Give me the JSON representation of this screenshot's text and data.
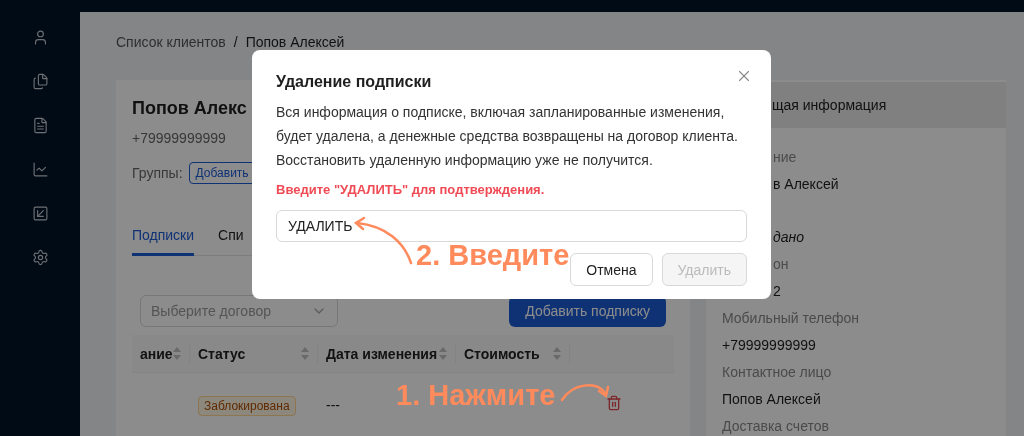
{
  "breadcrumb": {
    "items": [
      "Список клиентов",
      "Попов Алексей"
    ],
    "separator": "/"
  },
  "client": {
    "name": "Попов Алекс",
    "phone": "+79999999999",
    "groups_label": "Группы:",
    "groups_button": "Добавить"
  },
  "tabs": [
    {
      "label": "Подписки",
      "selected": true
    },
    {
      "label": "Спи",
      "selected": false
    }
  ],
  "contract_select": {
    "placeholder": "Выберите договор"
  },
  "add_button": "Добавить подписку",
  "table": {
    "columns": [
      "ание",
      "Статус",
      "Дата изменения",
      "Стоимость"
    ],
    "rows": [
      {
        "status": "Заблокирована",
        "changed": "---"
      }
    ]
  },
  "info_panel": {
    "title": "щая информация",
    "items": [
      {
        "kind": "label",
        "text": "ние",
        "clipped": true
      },
      {
        "kind": "value",
        "text": "в Алексей",
        "clipped": true
      },
      {
        "kind": "note",
        "text": "дано",
        "clipped": true
      },
      {
        "kind": "label",
        "text": "он",
        "clipped": true
      },
      {
        "kind": "value",
        "text": "2",
        "clipped": true
      },
      {
        "kind": "label",
        "text": "Мобильный телефон",
        "clipped": false
      },
      {
        "kind": "value",
        "text": "+79999999999",
        "clipped": false
      },
      {
        "kind": "label",
        "text": "Контактное лицо",
        "clipped": false
      },
      {
        "kind": "value",
        "text": "Попов Алексей",
        "clipped": false
      },
      {
        "kind": "label",
        "text": "Доставка счетов",
        "clipped": false
      }
    ]
  },
  "dialog": {
    "title": "Удаление подписки",
    "body": [
      "Вся информация о подписке, включая запланированные изменения,",
      "будет удалена, а денежные средства возвращены на договор клиента.",
      "Восстановить удаленную информацию уже не получится."
    ],
    "warning": "Введите \"УДАЛИТЬ\" для подтверждения.",
    "input_value": "УДАЛИТЬ",
    "buttons": [
      {
        "label": "Отмена",
        "disabled": false
      },
      {
        "label": "Удалить",
        "disabled": true
      }
    ]
  },
  "annotations": [
    {
      "text": "2. Введите"
    },
    {
      "text": "1. Нажмите"
    }
  ]
}
